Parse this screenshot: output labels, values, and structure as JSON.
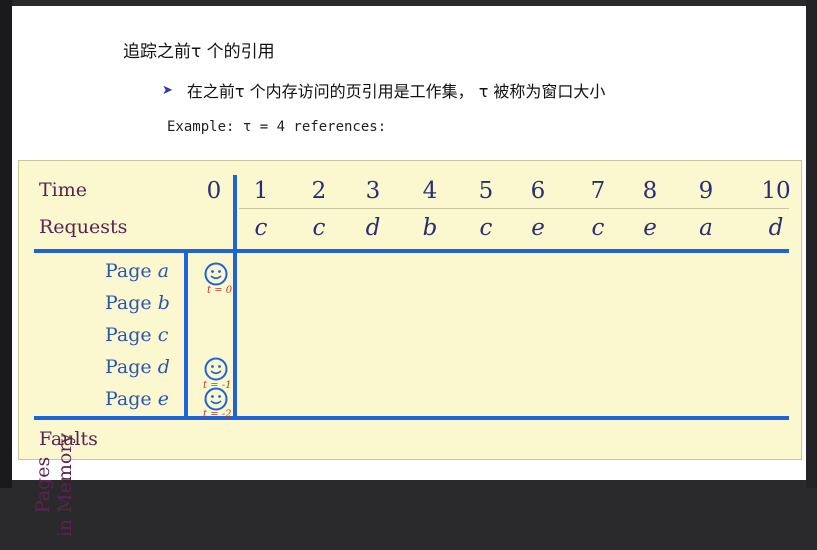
{
  "slide": {
    "bullet1": "追踪之前τ 个的引用",
    "bullet2": "在之前τ 个内存访问的页引用是工作集， τ 被称为窗口大小",
    "example": "Example:  τ  = 4 references:"
  },
  "table": {
    "time_label": "Time",
    "requests_label": "Requests",
    "faults_label": "Faults",
    "pages_label_line1": "Pages",
    "pages_label_line2": "in Memory",
    "time_values": [
      "0",
      "1",
      "2",
      "3",
      "4",
      "5",
      "6",
      "7",
      "8",
      "9",
      "10"
    ],
    "requests": [
      "c",
      "c",
      "d",
      "b",
      "c",
      "e",
      "c",
      "e",
      "a",
      "d"
    ],
    "pages": [
      {
        "prefix": "Page ",
        "letter": "a"
      },
      {
        "prefix": "Page ",
        "letter": "b"
      },
      {
        "prefix": "Page ",
        "letter": "c"
      },
      {
        "prefix": "Page ",
        "letter": "d"
      },
      {
        "prefix": "Page ",
        "letter": "e"
      }
    ],
    "markers": [
      {
        "page": "a",
        "label": "t = 0"
      },
      {
        "page": "d",
        "label": "t = -1"
      },
      {
        "page": "e",
        "label": "t = -2"
      }
    ]
  },
  "colors": {
    "table_bg": "#fbf8cf",
    "rule_blue": "#1f63d6",
    "label_purple": "#5a2352",
    "number_navy": "#2c2c74",
    "page_blue": "#2c56a8"
  }
}
